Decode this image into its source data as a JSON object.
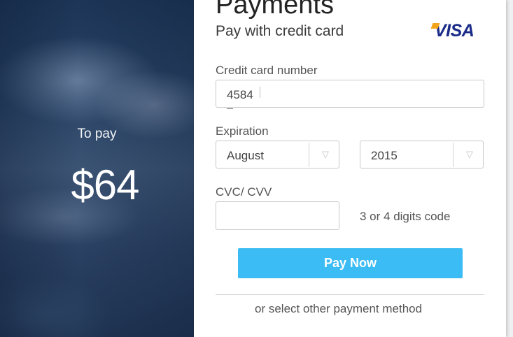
{
  "summary": {
    "to_pay_label": "To pay",
    "amount": "$64"
  },
  "form": {
    "title": "Payments",
    "subtitle": "Pay with credit card",
    "card_brand": "VISA",
    "card_number": {
      "label": "Credit card number",
      "value": "4584"
    },
    "expiration": {
      "label": "Expiration",
      "month": "August",
      "year": "2015"
    },
    "cvc": {
      "label": "CVC/ CVV",
      "value": "",
      "hint": "3 or 4 digits code"
    },
    "pay_button_label": "Pay Now",
    "other_method_link": "or select other payment method"
  },
  "colors": {
    "accent": "#3bbcf4",
    "visa_blue": "#1a2b88",
    "visa_gold": "#f4a51c"
  },
  "icons": {
    "select_arrow": "chevron-down-icon"
  }
}
